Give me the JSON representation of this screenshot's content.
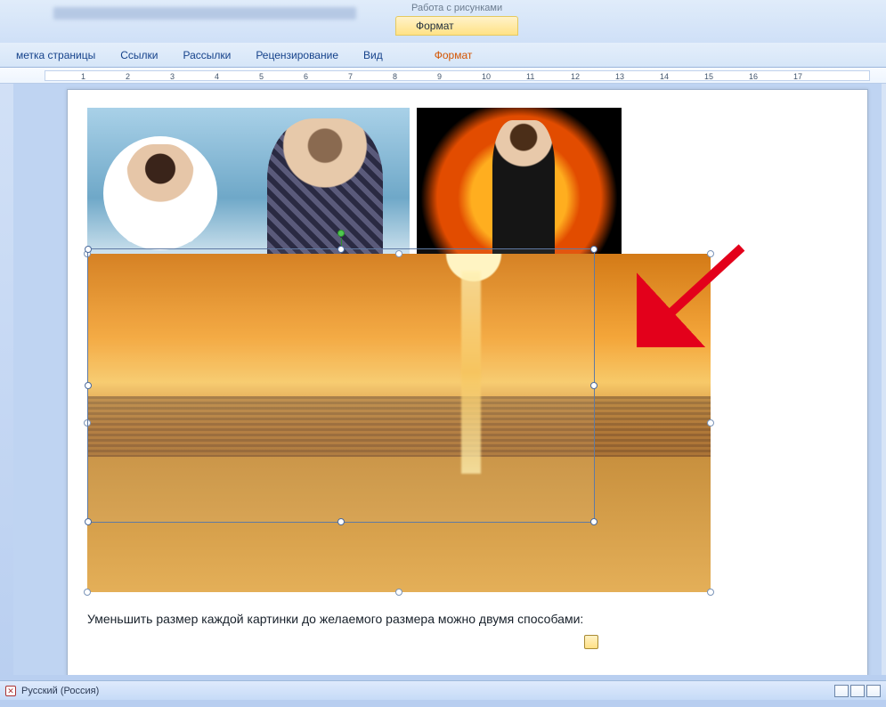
{
  "titlebar": {
    "context_group": "Работа с рисунками",
    "context_tab": "Формат"
  },
  "tabs": {
    "page_layout": "метка страницы",
    "references": "Ссылки",
    "mailings": "Рассылки",
    "review": "Рецензирование",
    "view": "Вид",
    "format": "Формат"
  },
  "ruler": {
    "start": 1,
    "end": 17
  },
  "document": {
    "body_text": "Уменьшить размер каждой картинки до желаемого размера можно двумя способами:"
  },
  "images": {
    "alt1": "photo-collage-two-people",
    "alt2": "woman-fire-background",
    "alt3": "beach-sunset"
  },
  "statusbar": {
    "language": "Русский (Россия)"
  }
}
